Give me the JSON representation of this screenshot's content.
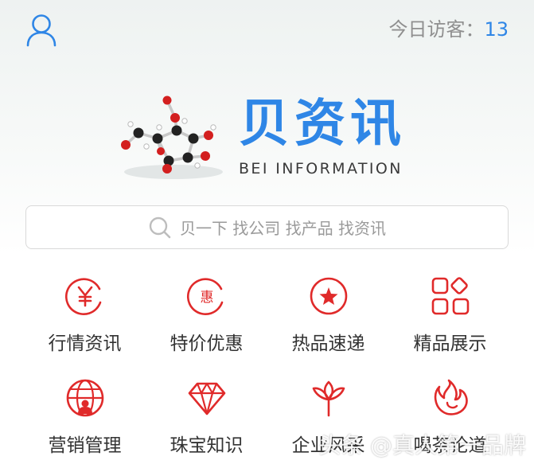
{
  "header": {
    "visitor_label": "今日访客：",
    "visitor_count": "13",
    "user_icon": "user-icon"
  },
  "logo": {
    "title": "贝资讯",
    "subtitle": "BEI INFORMATION"
  },
  "search": {
    "placeholder": "贝一下 找公司 找产品 找资讯"
  },
  "menu": [
    {
      "label": "行情资讯",
      "icon": "yen-circle-icon"
    },
    {
      "label": "特价优惠",
      "icon": "discount-circle-icon"
    },
    {
      "label": "热品速递",
      "icon": "star-circle-icon"
    },
    {
      "label": "精品展示",
      "icon": "grid-shapes-icon"
    },
    {
      "label": "营销管理",
      "icon": "globe-user-icon"
    },
    {
      "label": "珠宝知识",
      "icon": "diamond-icon"
    },
    {
      "label": "企业风采",
      "icon": "lotus-icon"
    },
    {
      "label": "喝茶论道",
      "icon": "flame-icon"
    }
  ],
  "watermark": "头条 @真人第一品牌",
  "colors": {
    "accent": "#2f86e6",
    "icon_red": "#e02a2a",
    "text": "#333333",
    "muted": "#8f8f8f"
  }
}
